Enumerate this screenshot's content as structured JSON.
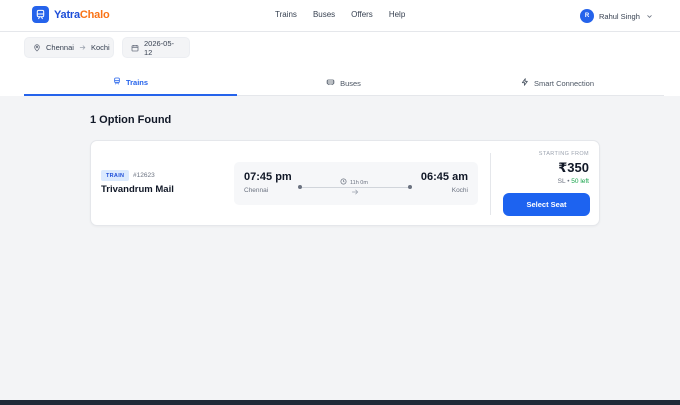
{
  "brand": {
    "part1": "Yatra",
    "part2": "Chalo",
    "accent": "#2563eb",
    "accent2": "#f97316"
  },
  "nav": {
    "items": [
      "Trains",
      "Buses",
      "Offers",
      "Help"
    ]
  },
  "user": {
    "initial": "R",
    "name": "Rahul Singh"
  },
  "search": {
    "from": "Chennai",
    "to": "Kochi",
    "date": "2026-05-12"
  },
  "tabs": [
    {
      "label": "Trains",
      "icon": "train-icon",
      "active": true
    },
    {
      "label": "Buses",
      "icon": "bus-icon",
      "active": false
    },
    {
      "label": "Smart Connection",
      "icon": "lightning-icon",
      "active": false
    }
  ],
  "results": {
    "title": "1 Option Found",
    "items": [
      {
        "badge": "TRAIN",
        "number": "#12623",
        "name": "Trivandrum Mail",
        "departure_time": "07:45 pm",
        "departure_city": "Chennai",
        "arrival_time": "06:45 am",
        "arrival_city": "Kochi",
        "duration": "11h 0m",
        "starting_label": "STARTING FROM",
        "price": "₹350",
        "class": "SL",
        "separator": "•",
        "seats_left": "50 left",
        "button": "Select Seat"
      }
    ]
  }
}
